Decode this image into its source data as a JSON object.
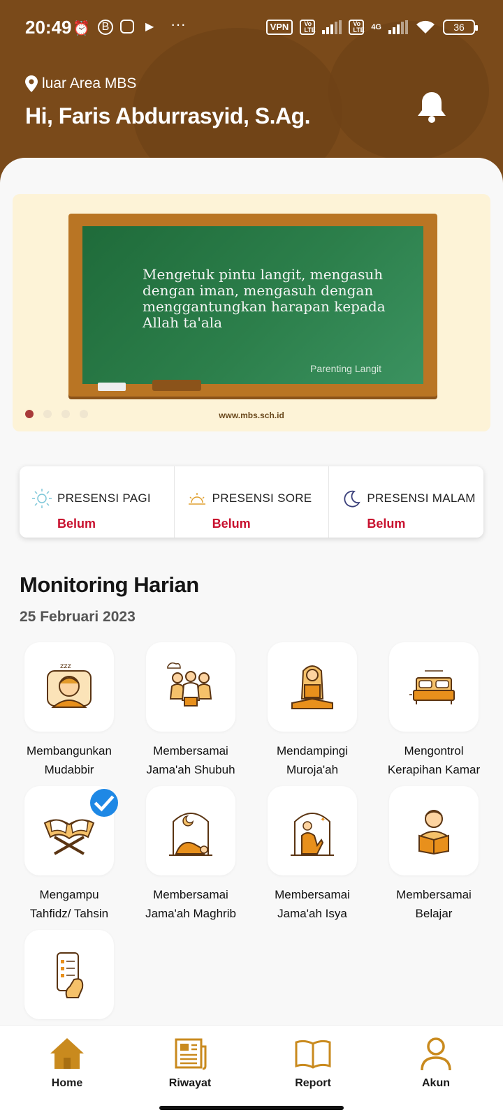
{
  "status_bar": {
    "time": "20:49",
    "vpn": "VPN",
    "volte": "Vo LTE",
    "network": "4G",
    "battery": "36"
  },
  "header": {
    "location": "luar Area MBS",
    "greeting": "Hi, Faris Abdurrasyid, S.Ag."
  },
  "banner": {
    "quote": "Mengetuk pintu langit, mengasuh dengan iman, mengasuh dengan menggantungkan harapan kepada Allah ta'ala",
    "author": "Parenting Langit",
    "site": "www.mbs.sch.id",
    "slides": 4,
    "active_slide": 1
  },
  "presensi": [
    {
      "title": "PRESENSI PAGI",
      "status": "Belum",
      "icon": "sun-icon"
    },
    {
      "title": "PRESENSI SORE",
      "status": "Belum",
      "icon": "sunset-icon"
    },
    {
      "title": "PRESENSI MALAM",
      "status": "Belum",
      "icon": "moon-icon"
    }
  ],
  "monitoring": {
    "title": "Monitoring Harian",
    "date": "25 Februari 2023",
    "items": [
      {
        "line1": "Membangunkan",
        "line2": "Mudabbir",
        "done": false
      },
      {
        "line1": "Membersamai",
        "line2": "Jama'ah Shubuh",
        "done": false
      },
      {
        "line1": "Mendampingi",
        "line2": "Muroja'ah",
        "done": false
      },
      {
        "line1": "Mengontrol",
        "line2": "Kerapihan Kamar",
        "done": false
      },
      {
        "line1": "Mengampu",
        "line2": "Tahfidz/ Tahsin",
        "done": true
      },
      {
        "line1": "Membersamai",
        "line2": "Jama'ah Maghrib",
        "done": false
      },
      {
        "line1": "Membersamai",
        "line2": "Jama'ah Isya",
        "done": false
      },
      {
        "line1": "Membersamai",
        "line2": "Belajar",
        "done": false
      },
      {
        "line1": "",
        "line2": "",
        "done": false
      }
    ]
  },
  "nav": {
    "home": "Home",
    "riwayat": "Riwayat",
    "report": "Report",
    "akun": "Akun"
  },
  "colors": {
    "header_brown": "#7a4a1a",
    "accent_gold": "#d79a2a",
    "status_red": "#c8102e",
    "check_blue": "#1e88e5"
  }
}
